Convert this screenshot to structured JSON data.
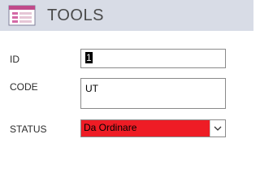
{
  "form": {
    "title": "TOOLS",
    "icon": "form-icon"
  },
  "fields": {
    "id": {
      "label": "ID",
      "value": "1"
    },
    "code": {
      "label": "CODE",
      "value": "UT"
    },
    "status": {
      "label": "STATUS",
      "value": "Da Ordinare",
      "background_color": "#ee1c25",
      "arrow_icon": "chevron-down-icon"
    }
  },
  "colors": {
    "header_background": "#d8dce6",
    "title_text": "#4a4a4a",
    "status_highlight": "#ee1c25"
  }
}
